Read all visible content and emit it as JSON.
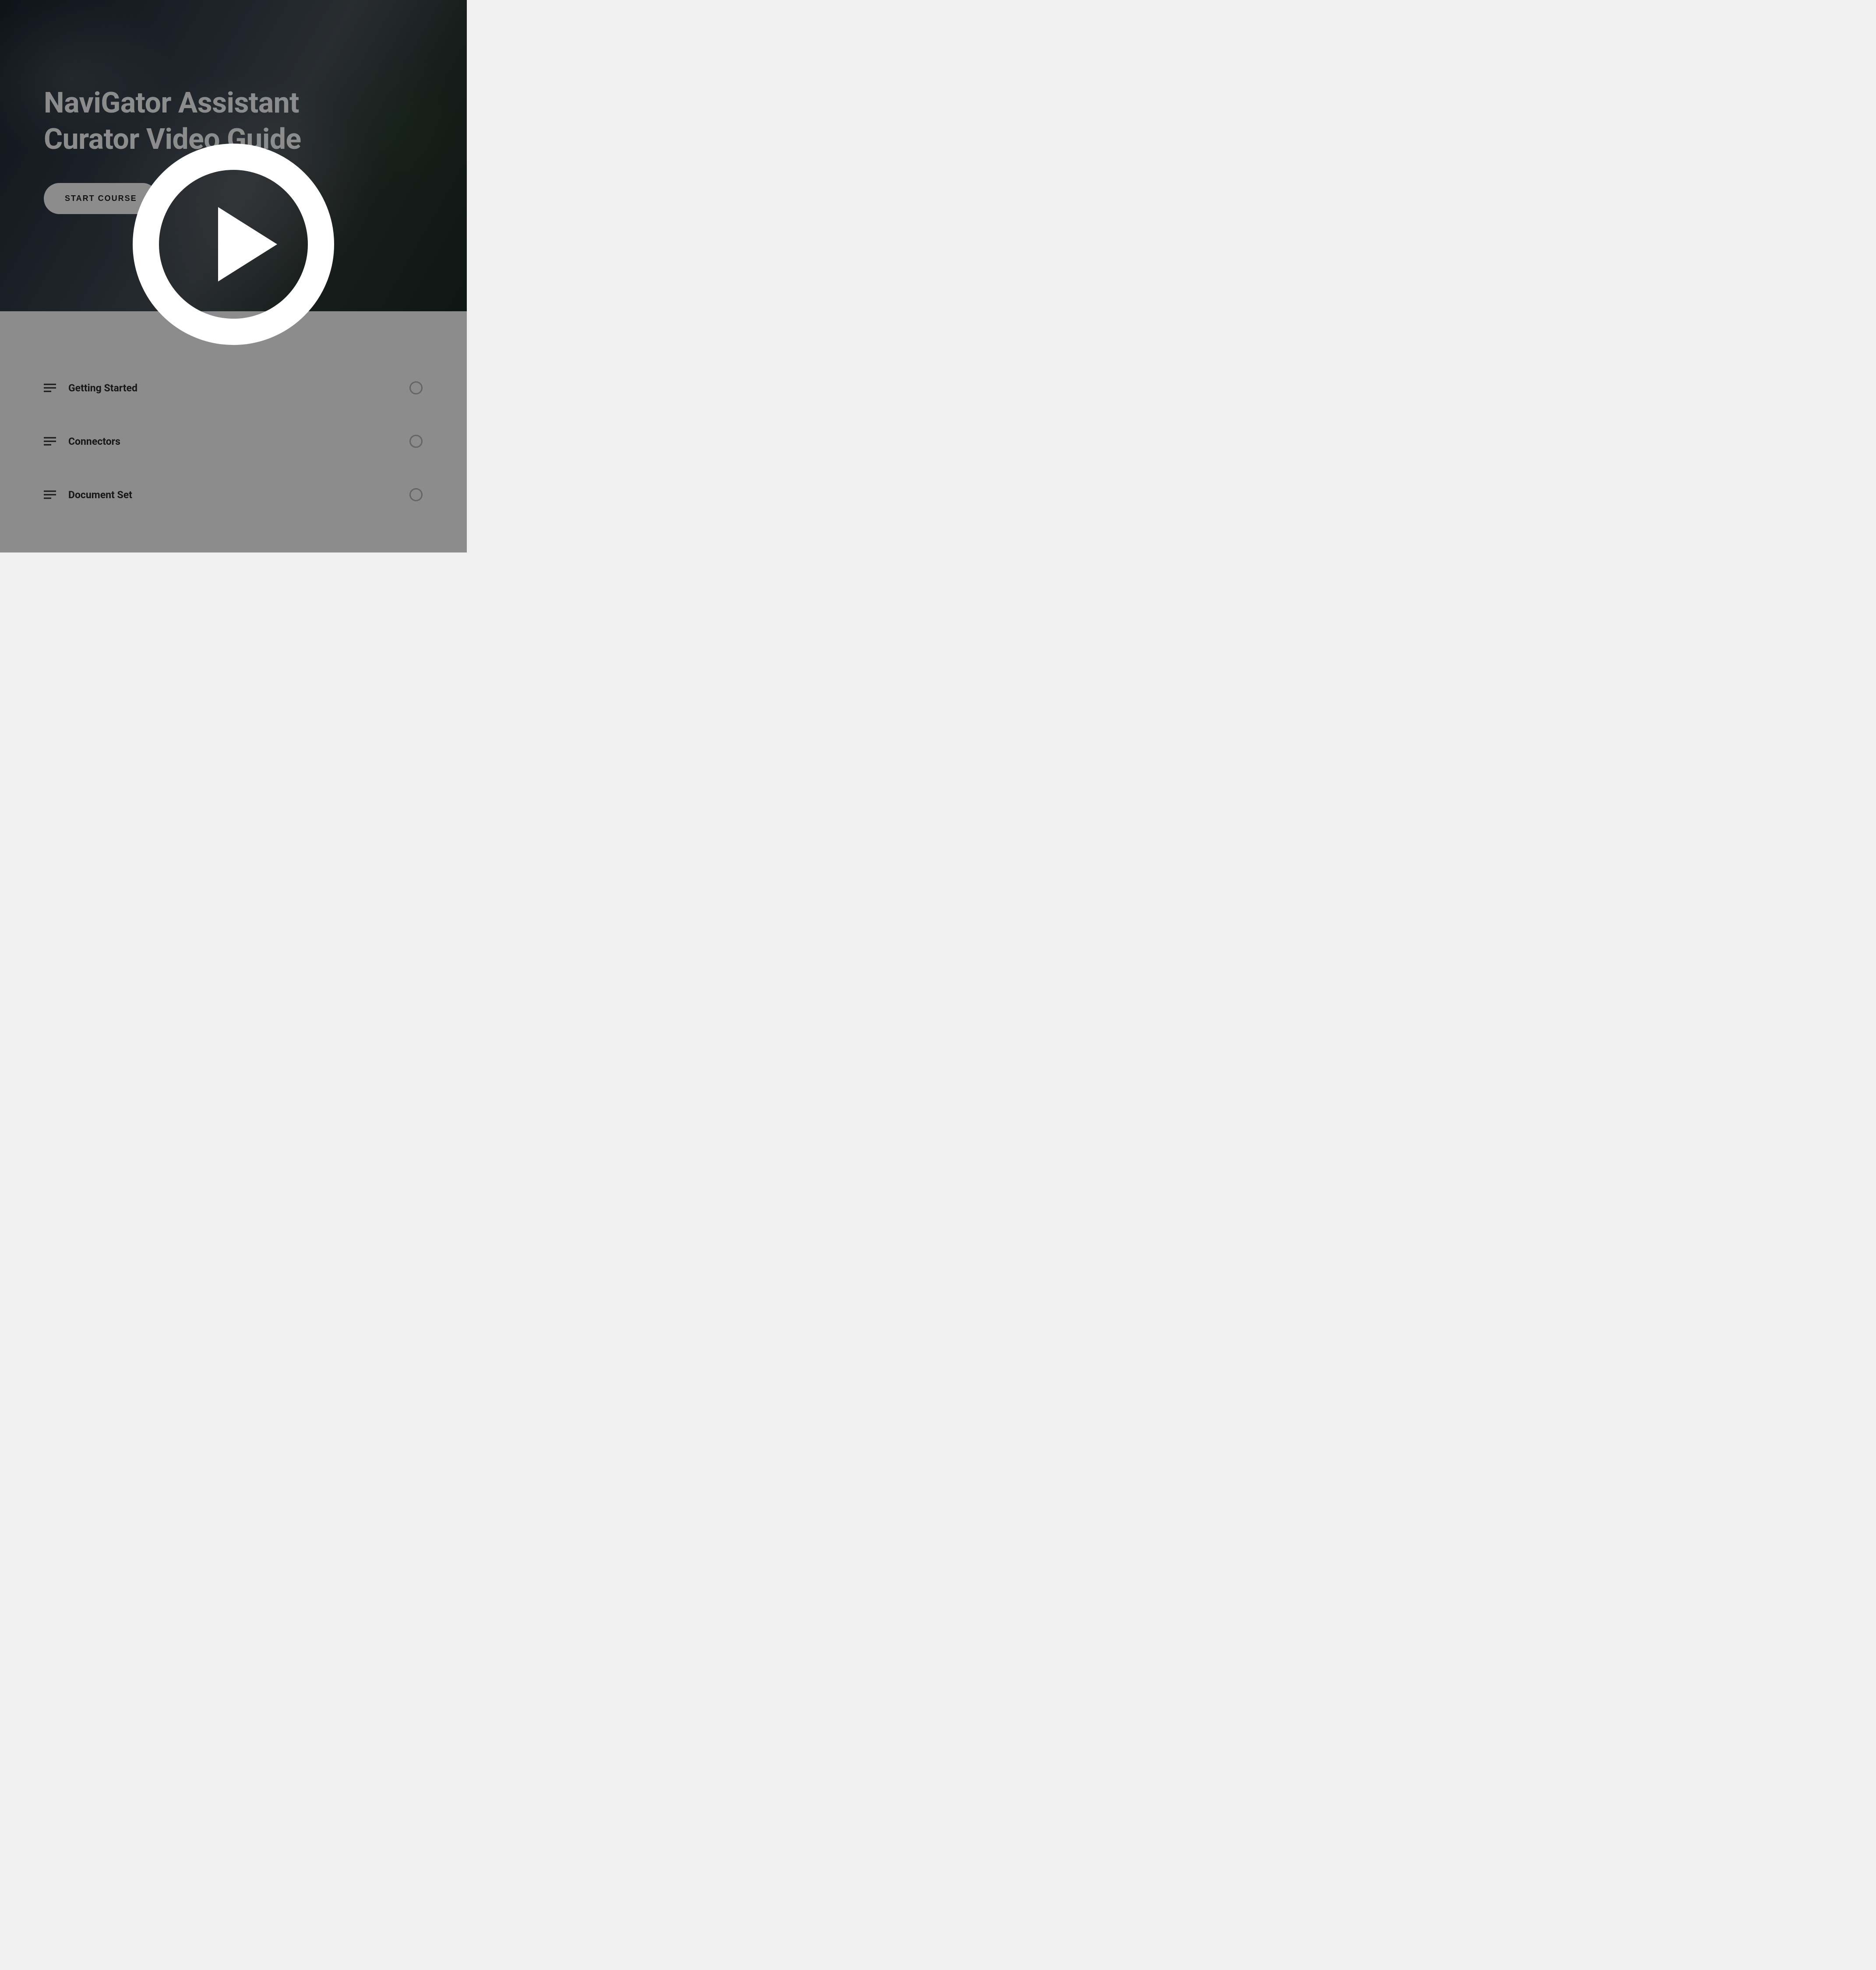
{
  "hero": {
    "title": "NaviGator Assistant Curator Video Guide",
    "start_button_label": "START COURSE"
  },
  "curriculum": {
    "lessons": [
      {
        "title": "Getting Started"
      },
      {
        "title": "Connectors"
      },
      {
        "title": "Document Set"
      }
    ]
  },
  "overlay": {
    "play_button": "play-icon"
  }
}
